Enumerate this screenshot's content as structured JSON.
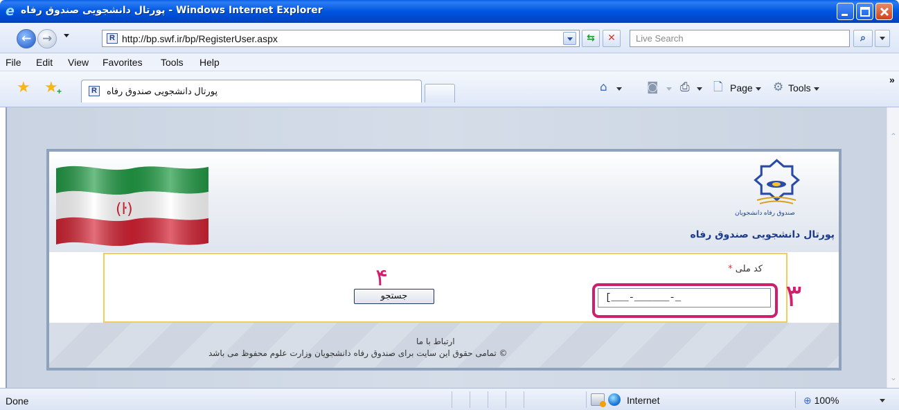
{
  "window": {
    "title": "پورتال دانشجویی صندوق رفاه - Windows Internet Explorer",
    "icon": "ie-icon"
  },
  "address_bar": {
    "url": "http://bp.swf.ir/bp/RegisterUser.aspx",
    "search_placeholder": "Live Search"
  },
  "menu": {
    "items": [
      "File",
      "Edit",
      "View",
      "Favorites",
      "Tools",
      "Help"
    ]
  },
  "tabs": {
    "active_label": "پورتال دانشجویی صندوق رفاه"
  },
  "command_bar": {
    "page_label": "Page",
    "tools_label": "Tools",
    "more": "»"
  },
  "page": {
    "logo_caption": "صندوق رفاه دانشجویان",
    "portal_title": "پورتال دانشجویی صندوق رفاه",
    "national_code_label": "کد ملی",
    "required_mark": "*",
    "national_code_value": "[___-______-_",
    "search_button": "جستجو",
    "annotation_3": "۳",
    "annotation_4": "۴",
    "contact_link": "ارتباط با ما",
    "copyright": "© تمامی حقوق این سایت برای صندوق رفاه دانشجویان وزارت علوم محفوظ می باشد"
  },
  "status_bar": {
    "status": "Done",
    "zone": "Internet",
    "zoom": "100%"
  },
  "colors": {
    "titlebar": "#0055e0",
    "annotation": "#d11f6d",
    "form_border": "#f2cc5d",
    "portal_title": "#1d3a8c"
  }
}
